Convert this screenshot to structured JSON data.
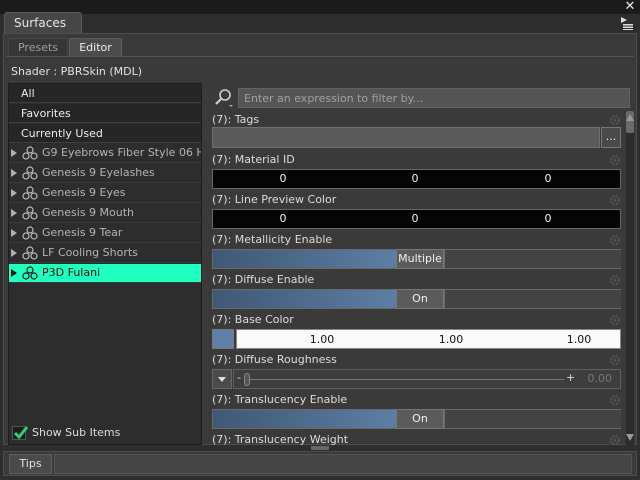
{
  "window": {
    "title": "Surfaces",
    "close_glyph": "✕"
  },
  "tabs": [
    {
      "label": "Presets",
      "active": false
    },
    {
      "label": "Editor",
      "active": true
    }
  ],
  "shader": {
    "label": "Shader :",
    "value": "PBRSkin (MDL)"
  },
  "left_list": {
    "filters": [
      "All",
      "Favorites",
      "Currently Used"
    ],
    "nodes": [
      {
        "label": "G9 Eyebrows Fiber Style 06 H…",
        "selected": false
      },
      {
        "label": "Genesis 9 Eyelashes",
        "selected": false
      },
      {
        "label": "Genesis 9 Eyes",
        "selected": false
      },
      {
        "label": "Genesis 9 Mouth",
        "selected": false
      },
      {
        "label": "Genesis 9 Tear",
        "selected": false
      },
      {
        "label": "LF Cooling Shorts",
        "selected": false
      },
      {
        "label": "P3D Fulani",
        "selected": true
      }
    ],
    "show_sub_items": {
      "label": "Show Sub Items",
      "checked": true
    }
  },
  "filter": {
    "placeholder": "Enter an expression to filter by..."
  },
  "properties": [
    {
      "label": "(7): Tags",
      "kind": "text",
      "button": "..."
    },
    {
      "label": "(7): Material ID",
      "kind": "numbers",
      "values": [
        "0",
        "0",
        "0"
      ]
    },
    {
      "label": "(7): Line Preview Color",
      "kind": "numbers",
      "values": [
        "0",
        "0",
        "0"
      ]
    },
    {
      "label": "(7): Metallicity Enable",
      "kind": "toggle",
      "state": "Multiple",
      "fill": 0.47
    },
    {
      "label": "(7): Diffuse Enable",
      "kind": "toggle",
      "state": "On",
      "fill": 0.47
    },
    {
      "label": "(7): Base Color",
      "kind": "color",
      "swatch": "#5f7fa6",
      "values": [
        "1.00",
        "1.00",
        "1.00"
      ]
    },
    {
      "label": "(7): Diffuse Roughness",
      "kind": "slider",
      "minus": "-",
      "plus": "+",
      "value": "0.00"
    },
    {
      "label": "(7): Translucency Enable",
      "kind": "toggle",
      "state": "On",
      "fill": 0.47
    },
    {
      "label": "(7): Translucency Weight",
      "kind": "partial"
    }
  ],
  "footer": {
    "tips_label": "Tips"
  },
  "colors": {
    "selection": "#1fffc0",
    "toggle_fill": "#5f7fa6",
    "panel": "#3a3a3a"
  }
}
